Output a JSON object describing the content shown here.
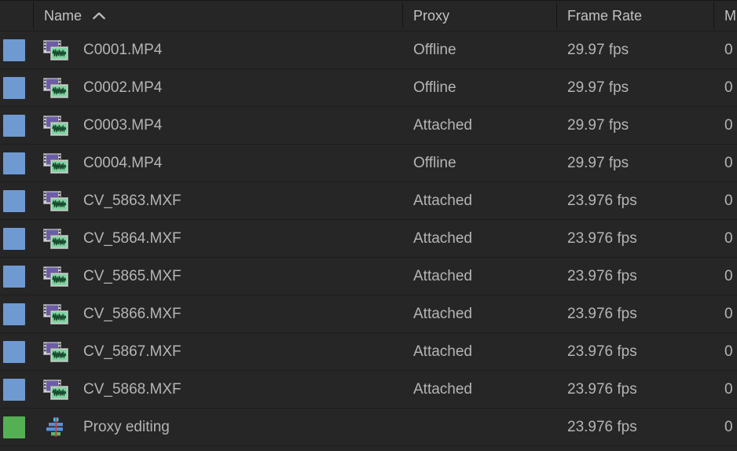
{
  "header": {
    "columns": [
      {
        "key": "swatch",
        "label": "",
        "icon": "color-swatch-column"
      },
      {
        "key": "name",
        "label": "Name",
        "sort": "ascending",
        "sort_icon": "chevron-up-icon"
      },
      {
        "key": "proxy",
        "label": "Proxy"
      },
      {
        "key": "rate",
        "label": "Frame Rate"
      },
      {
        "key": "more",
        "label": "M"
      }
    ]
  },
  "colors": {
    "background": "#262626",
    "row_divider": "#1d1d1d",
    "header_text": "#c2c2c2",
    "row_text": "#b5b5b5",
    "swatch_blue": "#6f99d1",
    "swatch_green": "#55b054"
  },
  "rows": [
    {
      "swatch": "#6f99d1",
      "icon": "video-clip-icon",
      "name": "C0001.MP4",
      "proxy": "Offline",
      "frame_rate": "29.97 fps",
      "more": "0"
    },
    {
      "swatch": "#6f99d1",
      "icon": "video-clip-icon",
      "name": "C0002.MP4",
      "proxy": "Offline",
      "frame_rate": "29.97 fps",
      "more": "0"
    },
    {
      "swatch": "#6f99d1",
      "icon": "video-clip-icon",
      "name": "C0003.MP4",
      "proxy": "Attached",
      "frame_rate": "29.97 fps",
      "more": "0"
    },
    {
      "swatch": "#6f99d1",
      "icon": "video-clip-icon",
      "name": "C0004.MP4",
      "proxy": "Offline",
      "frame_rate": "29.97 fps",
      "more": "0"
    },
    {
      "swatch": "#6f99d1",
      "icon": "video-clip-icon",
      "name": "CV_5863.MXF",
      "proxy": "Attached",
      "frame_rate": "23.976 fps",
      "more": "0"
    },
    {
      "swatch": "#6f99d1",
      "icon": "video-clip-icon",
      "name": "CV_5864.MXF",
      "proxy": "Attached",
      "frame_rate": "23.976 fps",
      "more": "0"
    },
    {
      "swatch": "#6f99d1",
      "icon": "video-clip-icon",
      "name": "CV_5865.MXF",
      "proxy": "Attached",
      "frame_rate": "23.976 fps",
      "more": "0"
    },
    {
      "swatch": "#6f99d1",
      "icon": "video-clip-icon",
      "name": "CV_5866.MXF",
      "proxy": "Attached",
      "frame_rate": "23.976 fps",
      "more": "0"
    },
    {
      "swatch": "#6f99d1",
      "icon": "video-clip-icon",
      "name": "CV_5867.MXF",
      "proxy": "Attached",
      "frame_rate": "23.976 fps",
      "more": "0"
    },
    {
      "swatch": "#6f99d1",
      "icon": "video-clip-icon",
      "name": "CV_5868.MXF",
      "proxy": "Attached",
      "frame_rate": "23.976 fps",
      "more": "0"
    },
    {
      "swatch": "#55b054",
      "icon": "timeline-sequence-icon",
      "name": "Proxy editing",
      "proxy": "",
      "frame_rate": "23.976 fps",
      "more": "0"
    }
  ]
}
